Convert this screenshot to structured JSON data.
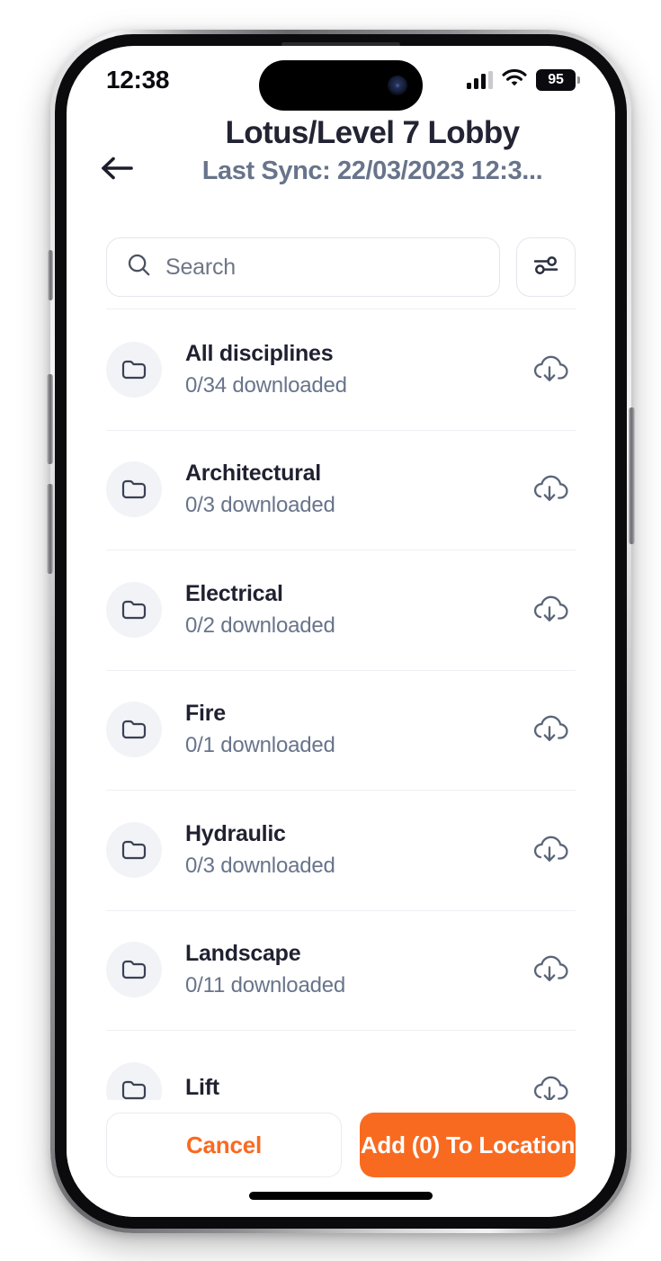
{
  "status_bar": {
    "time": "12:38",
    "battery_level": "95",
    "cellular_icon": "cellular-signal-icon",
    "wifi_icon": "wifi-icon",
    "battery_icon": "battery-icon"
  },
  "header": {
    "back_icon": "back-arrow-icon",
    "title": "Lotus/Level 7 Lobby",
    "subtitle": "Last Sync: 22/03/2023 12:3..."
  },
  "search": {
    "placeholder": "Search",
    "icon": "search-icon",
    "filter_icon": "filter-sliders-icon"
  },
  "list": {
    "rows": [
      {
        "title": "All disciplines",
        "subtitle": "0/34 downloaded",
        "icon": "folder-icon",
        "action_icon": "cloud-download-icon"
      },
      {
        "title": "Architectural",
        "subtitle": "0/3 downloaded",
        "icon": "folder-icon",
        "action_icon": "cloud-download-icon"
      },
      {
        "title": "Electrical",
        "subtitle": "0/2 downloaded",
        "icon": "folder-icon",
        "action_icon": "cloud-download-icon"
      },
      {
        "title": "Fire",
        "subtitle": "0/1 downloaded",
        "icon": "folder-icon",
        "action_icon": "cloud-download-icon"
      },
      {
        "title": "Hydraulic",
        "subtitle": "0/3 downloaded",
        "icon": "folder-icon",
        "action_icon": "cloud-download-icon"
      },
      {
        "title": "Landscape",
        "subtitle": "0/11 downloaded",
        "icon": "folder-icon",
        "action_icon": "cloud-download-icon"
      },
      {
        "title": "Lift",
        "subtitle": "",
        "icon": "folder-icon",
        "action_icon": "cloud-download-icon"
      }
    ]
  },
  "footer": {
    "cancel_label": "Cancel",
    "add_label": "Add (0) To Location"
  },
  "colors": {
    "accent_orange": "#F96A21",
    "text_primary": "#1F2130",
    "text_secondary": "#68748B",
    "divider": "#EDEFF3",
    "icon_bubble": "#F1F3F7",
    "border": "#E3E6EC"
  }
}
